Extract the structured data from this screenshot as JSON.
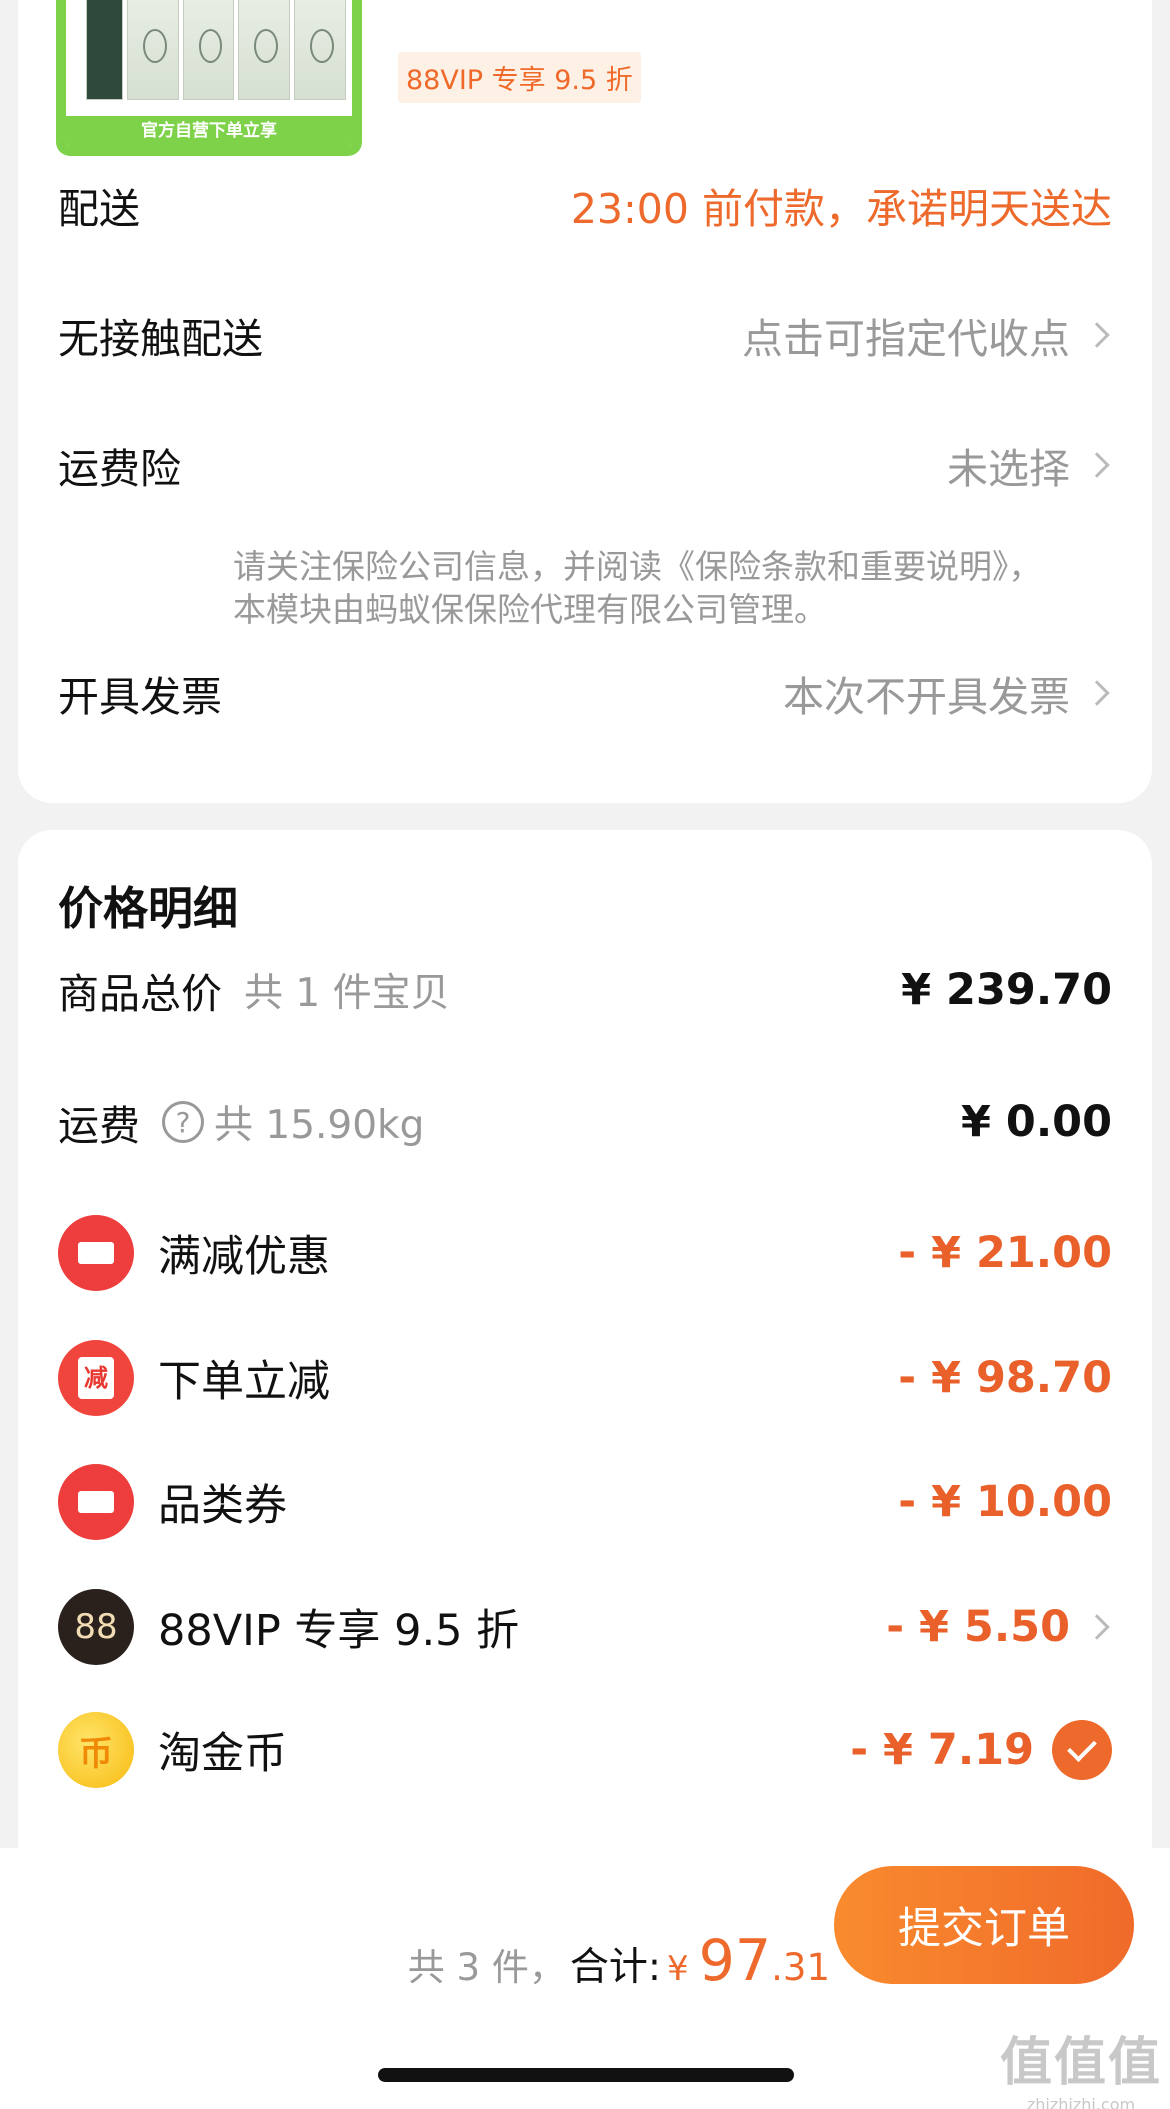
{
  "product": {
    "thumb_banner": "官方自营下单立享",
    "vip_tag": "88VIP 专享 9.5 折"
  },
  "order_options": {
    "delivery": {
      "label": "配送",
      "value": "23:00 前付款，承诺明天送达"
    },
    "contactless": {
      "label": "无接触配送",
      "value": "点击可指定代收点"
    },
    "freight_insurance": {
      "label": "运费险",
      "value": "未选择",
      "note": "请关注保险公司信息，并阅读《保险条款和重要说明》，本模块由蚂蚁保保险代理有限公司管理。"
    },
    "invoice": {
      "label": "开具发票",
      "value": "本次不开具发票"
    }
  },
  "price_detail": {
    "title": "价格明细",
    "goods_total": {
      "label": "商品总价",
      "sub": "共 1 件宝贝",
      "amount": "¥ 239.70"
    },
    "shipping": {
      "label": "运费",
      "sub": "共 15.90kg",
      "amount": "¥ 0.00",
      "help_glyph": "?"
    },
    "discounts": [
      {
        "label": "满减优惠",
        "amount": "- ¥ 21.00",
        "icon": "coupon-icon"
      },
      {
        "label": "下单立减",
        "amount": "- ¥ 98.70",
        "icon": "jian-icon",
        "icon_text": "减"
      },
      {
        "label": "品类券",
        "amount": "- ¥ 10.00",
        "icon": "coupon-icon"
      },
      {
        "label": "88VIP 专享 9.5 折",
        "amount": "- ¥ 5.50",
        "icon": "vip88-icon",
        "icon_text": "88"
      },
      {
        "label": "淘金币",
        "amount": "- ¥ 7.19",
        "icon": "coin-icon",
        "icon_text": "币"
      }
    ]
  },
  "footer": {
    "count": "共 3 件，",
    "total_label": "合计:",
    "currency": "¥",
    "total_int": "97",
    "total_dec": ".31",
    "submit_label": "提交订单"
  },
  "watermark": {
    "big": "值值值",
    "small": "zhizhizhi.com"
  },
  "colors": {
    "accent": "#ee6a2c",
    "red": "#ee3d3d",
    "green": "#7ed24a"
  }
}
